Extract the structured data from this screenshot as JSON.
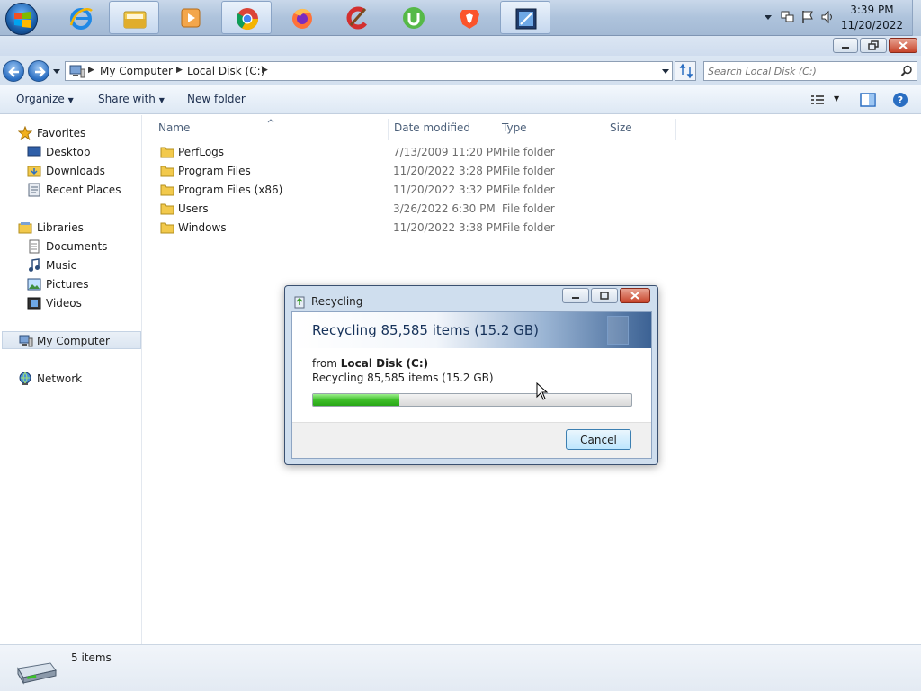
{
  "taskbar": {
    "apps": [
      {
        "name": "internet-explorer-icon"
      },
      {
        "name": "windows-explorer-icon",
        "active": true
      },
      {
        "name": "media-player-icon"
      },
      {
        "name": "chrome-icon",
        "active": true
      },
      {
        "name": "firefox-icon"
      },
      {
        "name": "ccleaner-icon"
      },
      {
        "name": "utorrent-icon"
      },
      {
        "name": "brave-icon"
      },
      {
        "name": "app-icon",
        "active": true
      }
    ],
    "clock": {
      "time": "3:39 PM",
      "date": "11/20/2022"
    }
  },
  "address": {
    "crumbs": [
      "My Computer",
      "Local Disk (C:)"
    ]
  },
  "search": {
    "placeholder": "Search Local Disk (C:)"
  },
  "toolbar": {
    "organize": "Organize",
    "share_with": "Share with",
    "new_folder": "New folder"
  },
  "nav": {
    "favorites": {
      "label": "Favorites",
      "items": [
        "Desktop",
        "Downloads",
        "Recent Places"
      ]
    },
    "libraries": {
      "label": "Libraries",
      "items": [
        "Documents",
        "Music",
        "Pictures",
        "Videos"
      ]
    },
    "computer": "My Computer",
    "network": "Network"
  },
  "columns": {
    "name": "Name",
    "date": "Date modified",
    "type": "Type",
    "size": "Size"
  },
  "files": [
    {
      "name": "PerfLogs",
      "date": "7/13/2009 11:20 PM",
      "type": "File folder"
    },
    {
      "name": "Program Files",
      "date": "11/20/2022 3:28 PM",
      "type": "File folder"
    },
    {
      "name": "Program Files (x86)",
      "date": "11/20/2022 3:32 PM",
      "type": "File folder"
    },
    {
      "name": "Users",
      "date": "3/26/2022 6:30 PM",
      "type": "File folder"
    },
    {
      "name": "Windows",
      "date": "11/20/2022 3:38 PM",
      "type": "File folder"
    }
  ],
  "status": {
    "items": "5 items"
  },
  "dialog": {
    "title": "Recycling",
    "heading": "Recycling 85,585 items (15.2 GB)",
    "from_prefix": "from",
    "from_location": "Local Disk (C:)",
    "detail": "Recycling 85,585 items (15.2 GB)",
    "progress": 0.27,
    "cancel": "Cancel"
  },
  "colors": {
    "accent": "#2a6ec2",
    "progress": "#3fbf2a"
  }
}
